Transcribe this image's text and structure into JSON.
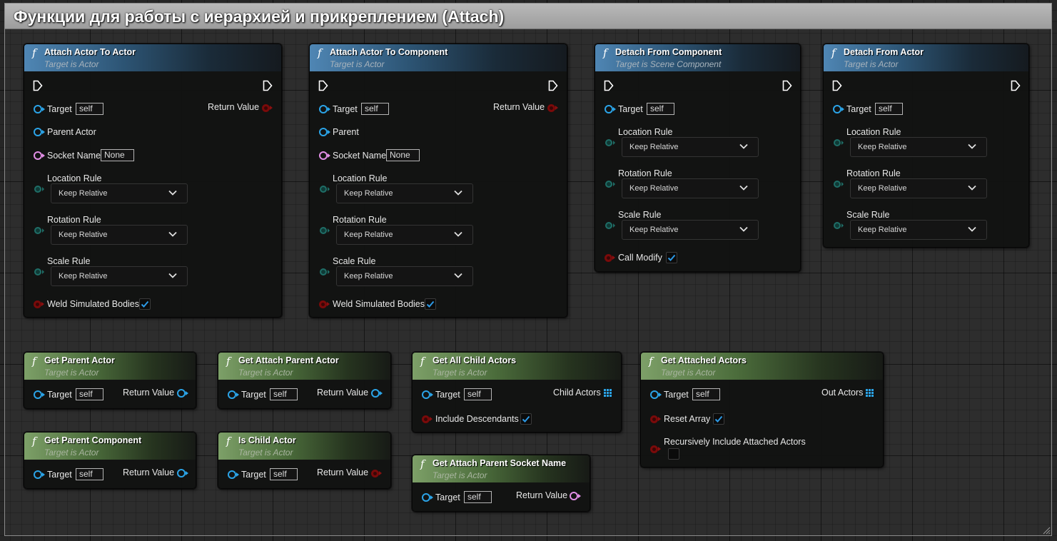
{
  "comment": {
    "title": "Функции для работы с иерархией и прикреплением (Attach)"
  },
  "common": {
    "fn_icon": "f",
    "target": "Target",
    "self": "self",
    "return_value": "Return Value",
    "keep_relative": "Keep Relative",
    "location_rule": "Location Rule",
    "rotation_rule": "Rotation Rule",
    "scale_rule": "Scale Rule",
    "weld_simulated_bodies": "Weld Simulated Bodies",
    "target_is_actor": "Target is Actor",
    "none": "None",
    "socket_name": "Socket Name"
  },
  "nodes": {
    "attach_actor_to_actor": {
      "title": "Attach Actor To Actor",
      "parent_pin": "Parent Actor",
      "weld_checked": true
    },
    "attach_actor_to_component": {
      "title": "Attach Actor To Component",
      "parent_pin": "Parent",
      "weld_checked": true
    },
    "detach_from_component": {
      "title": "Detach From Component",
      "subtitle": "Target is Scene Component",
      "call_modify": "Call Modify",
      "call_modify_checked": true
    },
    "detach_from_actor": {
      "title": "Detach From Actor"
    },
    "get_parent_actor": {
      "title": "Get Parent Actor"
    },
    "get_attach_parent_actor": {
      "title": "Get Attach Parent Actor"
    },
    "get_all_child_actors": {
      "title": "Get All Child Actors",
      "output": "Child Actors",
      "include_descendants": "Include Descendants",
      "include_descendants_checked": true
    },
    "get_attached_actors": {
      "title": "Get Attached Actors",
      "output": "Out Actors",
      "reset_array": "Reset Array",
      "reset_array_checked": true,
      "recursively": "Recursively Include Attached Actors",
      "recursively_checked": false
    },
    "get_parent_component": {
      "title": "Get Parent Component"
    },
    "is_child_actor": {
      "title": "Is Child Actor"
    },
    "get_attach_parent_socket_name": {
      "title": "Get Attach Parent Socket Name"
    }
  },
  "colors": {
    "object_pin": "#2ba4e8",
    "name_pin": "#e28fe6",
    "bool_pin": "#8a1010",
    "enum_pin": "#1f6e67",
    "pure_header": "#7da068",
    "impure_header": "#4f86b4"
  }
}
